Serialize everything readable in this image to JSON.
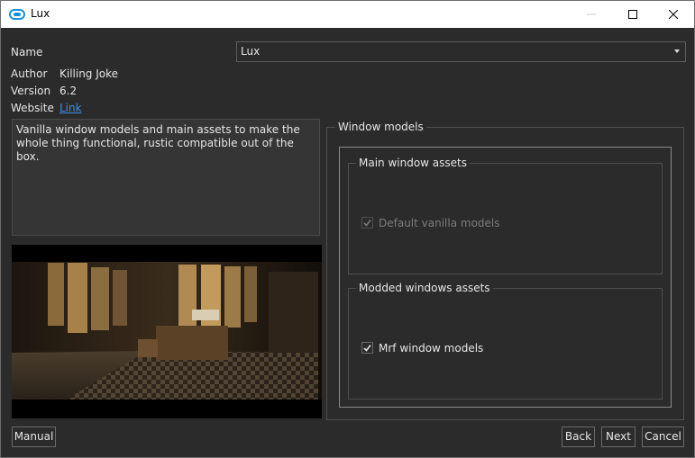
{
  "window": {
    "title": "Lux",
    "app_icon": "link-chain-icon"
  },
  "form": {
    "name_label": "Name",
    "name_value": "Lux",
    "author_label": "Author",
    "author_value": "Killing Joke",
    "version_label": "Version",
    "version_value": "6.2",
    "website_label": "Website",
    "website_link": "Link",
    "description": "Vanilla window models and main assets to make the whole thing functional, rustic compatible out of the box."
  },
  "window_models": {
    "title": "Window models",
    "main_assets": {
      "title": "Main window assets",
      "option_label": "Default vanilla models",
      "checked": true,
      "enabled": false
    },
    "modded_assets": {
      "title": "Modded windows assets",
      "option_label": "Mrf window models",
      "checked": true,
      "enabled": true
    }
  },
  "buttons": {
    "manual": "Manual",
    "back": "Back",
    "next": "Next",
    "cancel": "Cancel"
  },
  "colors": {
    "background": "#2b2b2b",
    "titlebar": "#ffffff",
    "link": "#3b8eea",
    "app_icon": "#1a8fd6"
  }
}
